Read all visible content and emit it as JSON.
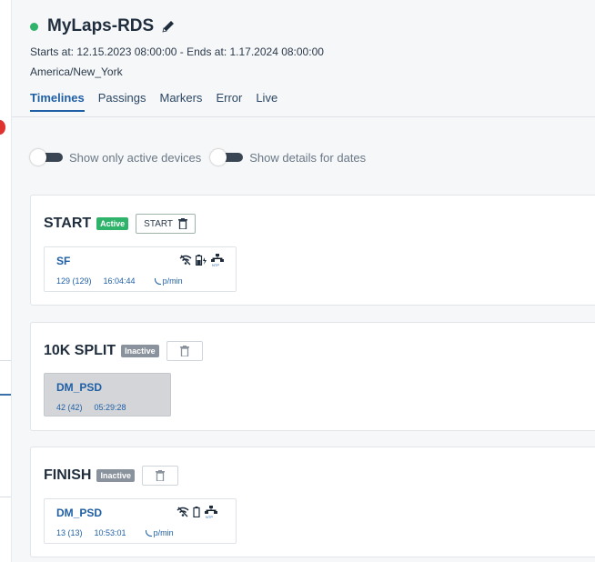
{
  "header": {
    "title": "MyLaps-RDS",
    "dates": "Starts at: 12.15.2023 08:00:00 - Ends at: 1.17.2024 08:00:00",
    "timezone": "America/New_York",
    "status_color": "#2fb36b"
  },
  "tabs": [
    {
      "label": "Timelines",
      "active": true
    },
    {
      "label": "Passings",
      "active": false
    },
    {
      "label": "Markers",
      "active": false
    },
    {
      "label": "Error",
      "active": false
    },
    {
      "label": "Live",
      "active": false
    }
  ],
  "filters": {
    "active_devices_label": "Show only active devices",
    "details_dates_label": "Show details for dates"
  },
  "timelines": [
    {
      "name": "START",
      "status": "Active",
      "button_label": "START",
      "device": {
        "name": "SF",
        "passings": "129 (129)",
        "time": "16:04:44",
        "rate": "p/min",
        "icons": [
          "wifi-off-icon",
          "battery-charging-icon",
          "ntp-icon"
        ]
      }
    },
    {
      "name": "10K SPLIT",
      "status": "Inactive",
      "button_label": "",
      "device": {
        "name": "DM_PSD",
        "passings": "42 (42)",
        "time": "05:29:28",
        "rate": "",
        "icons": []
      }
    },
    {
      "name": "FINISH",
      "status": "Inactive",
      "button_label": "",
      "device": {
        "name": "DM_PSD",
        "passings": "13 (13)",
        "time": "10:53:01",
        "rate": "p/min",
        "icons": [
          "wifi-off-icon",
          "battery-icon",
          "ntp-icon"
        ]
      }
    }
  ]
}
